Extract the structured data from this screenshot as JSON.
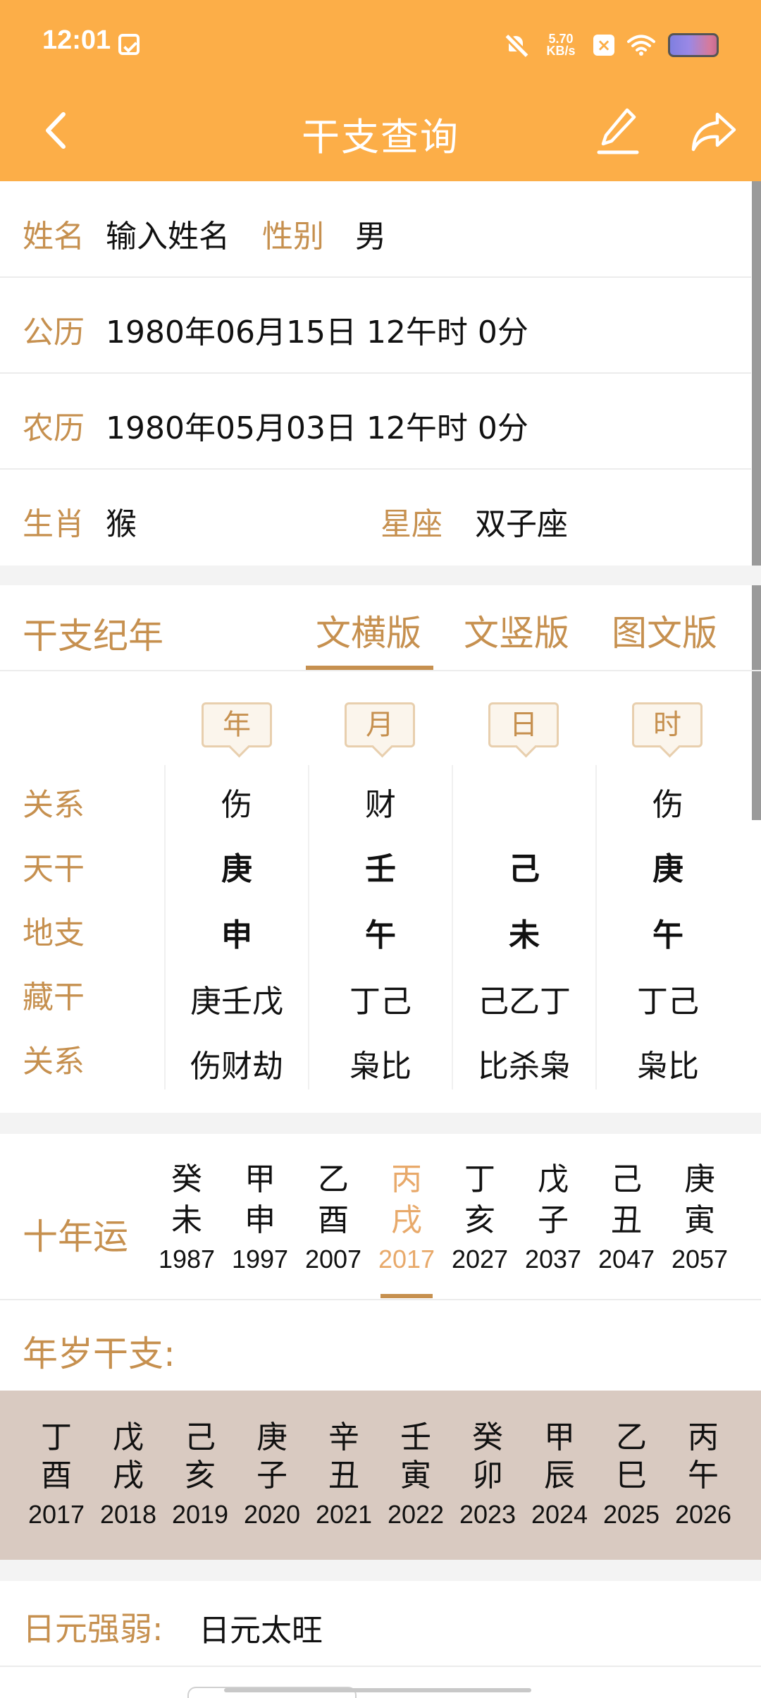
{
  "status_bar": {
    "time": "12:01",
    "net_speed_value": "5.70",
    "net_speed_unit": "KB/s"
  },
  "nav": {
    "title": "干支查询"
  },
  "info": {
    "name_label": "姓名",
    "name_placeholder": "输入姓名",
    "gender_label": "性别",
    "gender_value": "男",
    "solar_label": "公历",
    "solar_value": "1980年06月15日 12午时 0分",
    "lunar_label": "农历",
    "lunar_value": "1980年05月03日 12午时 0分",
    "zodiac_label": "生肖",
    "zodiac_value": "猴",
    "constellation_label": "星座",
    "constellation_value": "双子座"
  },
  "ganzhi": {
    "section_title": "干支纪年",
    "tabs": [
      "文横版",
      "文竖版",
      "图文版"
    ],
    "active_tab": 0,
    "pillar_headers": [
      "年",
      "月",
      "日",
      "时"
    ],
    "row_labels": [
      "关系",
      "天干",
      "地支",
      "藏干",
      "关系"
    ],
    "columns": [
      [
        "伤",
        "庚",
        "申",
        "庚壬戊",
        "伤财劫"
      ],
      [
        "财",
        "壬",
        "午",
        "丁己",
        "枭比"
      ],
      [
        "",
        "己",
        "未",
        "己乙丁",
        "比杀枭"
      ],
      [
        "伤",
        "庚",
        "午",
        "丁己",
        "枭比"
      ]
    ]
  },
  "decade": {
    "title": "十年运",
    "active_index": 3,
    "items": [
      {
        "gan": "癸",
        "zhi": "未",
        "year": "1987"
      },
      {
        "gan": "甲",
        "zhi": "申",
        "year": "1997"
      },
      {
        "gan": "乙",
        "zhi": "酉",
        "year": "2007"
      },
      {
        "gan": "丙",
        "zhi": "戌",
        "year": "2017"
      },
      {
        "gan": "丁",
        "zhi": "亥",
        "year": "2027"
      },
      {
        "gan": "戊",
        "zhi": "子",
        "year": "2037"
      },
      {
        "gan": "己",
        "zhi": "丑",
        "year": "2047"
      },
      {
        "gan": "庚",
        "zhi": "寅",
        "year": "2057"
      }
    ]
  },
  "annual": {
    "title": "年岁干支:",
    "items": [
      {
        "gan": "丁",
        "zhi": "酉",
        "year": "2017"
      },
      {
        "gan": "戊",
        "zhi": "戌",
        "year": "2018"
      },
      {
        "gan": "己",
        "zhi": "亥",
        "year": "2019"
      },
      {
        "gan": "庚",
        "zhi": "子",
        "year": "2020"
      },
      {
        "gan": "辛",
        "zhi": "丑",
        "year": "2021"
      },
      {
        "gan": "壬",
        "zhi": "寅",
        "year": "2022"
      },
      {
        "gan": "癸",
        "zhi": "卯",
        "year": "2023"
      },
      {
        "gan": "甲",
        "zhi": "辰",
        "year": "2024"
      },
      {
        "gan": "乙",
        "zhi": "巳",
        "year": "2025"
      },
      {
        "gan": "丙",
        "zhi": "午",
        "year": "2026"
      }
    ]
  },
  "strength": {
    "label": "日元强弱:",
    "value": "日元太旺"
  },
  "colors": {
    "header": "#FCAE48",
    "label_gold": "#C6904F",
    "active_decade": "#E8A96A",
    "annual_band": "#D9CAC1"
  }
}
